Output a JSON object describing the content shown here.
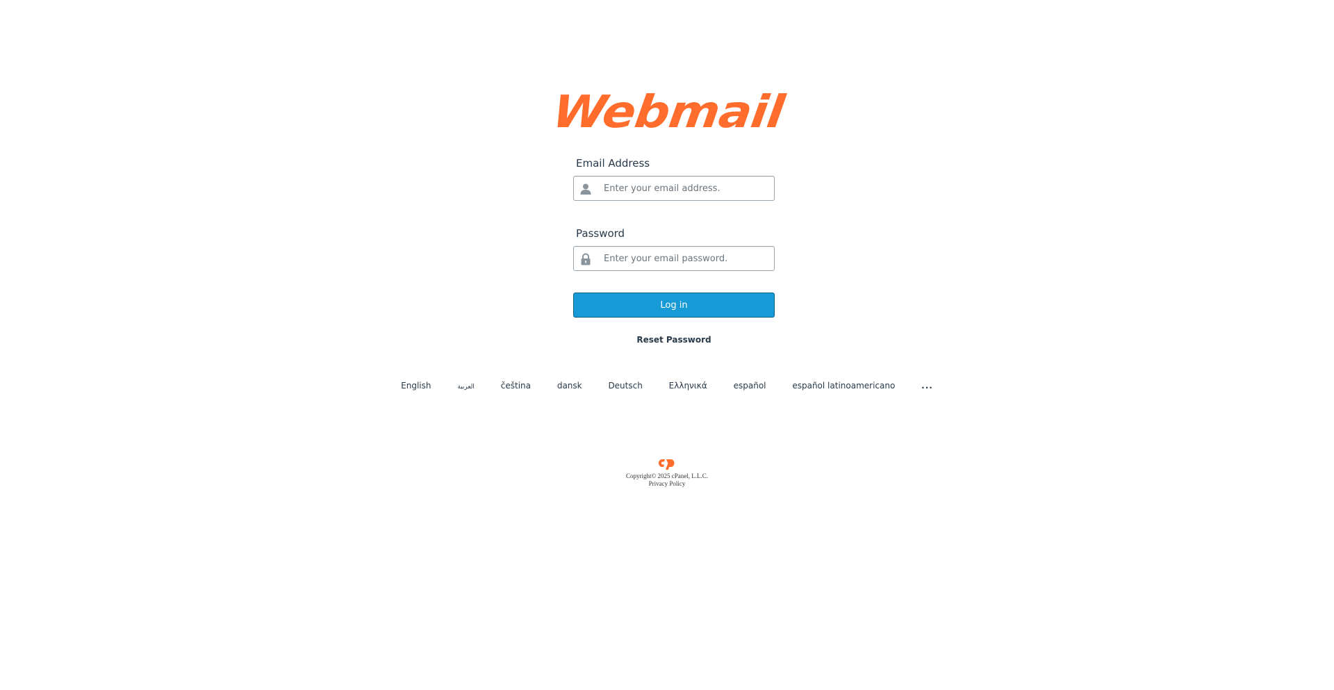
{
  "logo": {
    "text": "Webmail",
    "color": "#ff6c2c"
  },
  "form": {
    "email": {
      "label": "Email Address",
      "placeholder": "Enter your email address.",
      "value": "",
      "icon": "user-icon"
    },
    "password": {
      "label": "Password",
      "placeholder": "Enter your email password.",
      "value": "",
      "icon": "lock-icon"
    },
    "login_label": "Log in",
    "login_color": "#179bd7",
    "reset_label": "Reset Password"
  },
  "languages": {
    "items": [
      "English",
      "العربية",
      "čeština",
      "dansk",
      "Deutsch",
      "Ελληνικά",
      "español",
      "español latinoamericano"
    ],
    "more_label": "..."
  },
  "footer": {
    "logo_icon": "cpanel-logo-icon",
    "copyright": "Copyright© 2025 cPanel, L.L.C.",
    "privacy_label": "Privacy Policy"
  }
}
